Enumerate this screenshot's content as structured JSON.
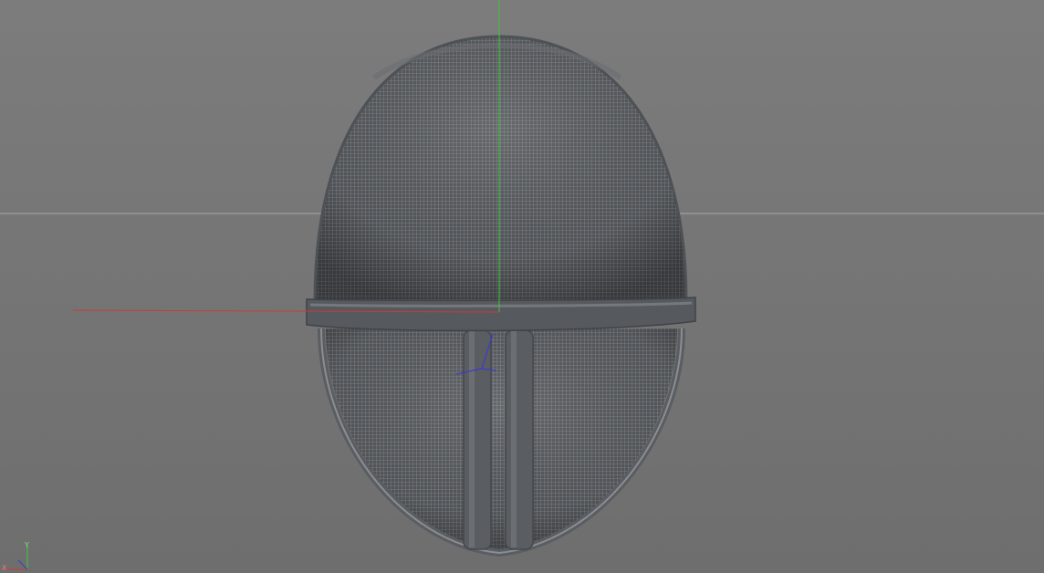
{
  "viewport": {
    "background_color": "#767676",
    "horizon_color": "#a8a8a8",
    "axis_colors": {
      "x": "#c83c3c",
      "y": "#3cc83c",
      "z": "#3c3cc8"
    },
    "model": {
      "name": "fencing-mask",
      "shell_color": "#5c5f63",
      "mesh_color": "#8a8d91",
      "band_color": "#4f5256"
    },
    "axis_gizmo": {
      "y_label": "Y",
      "x_label": "X"
    }
  }
}
